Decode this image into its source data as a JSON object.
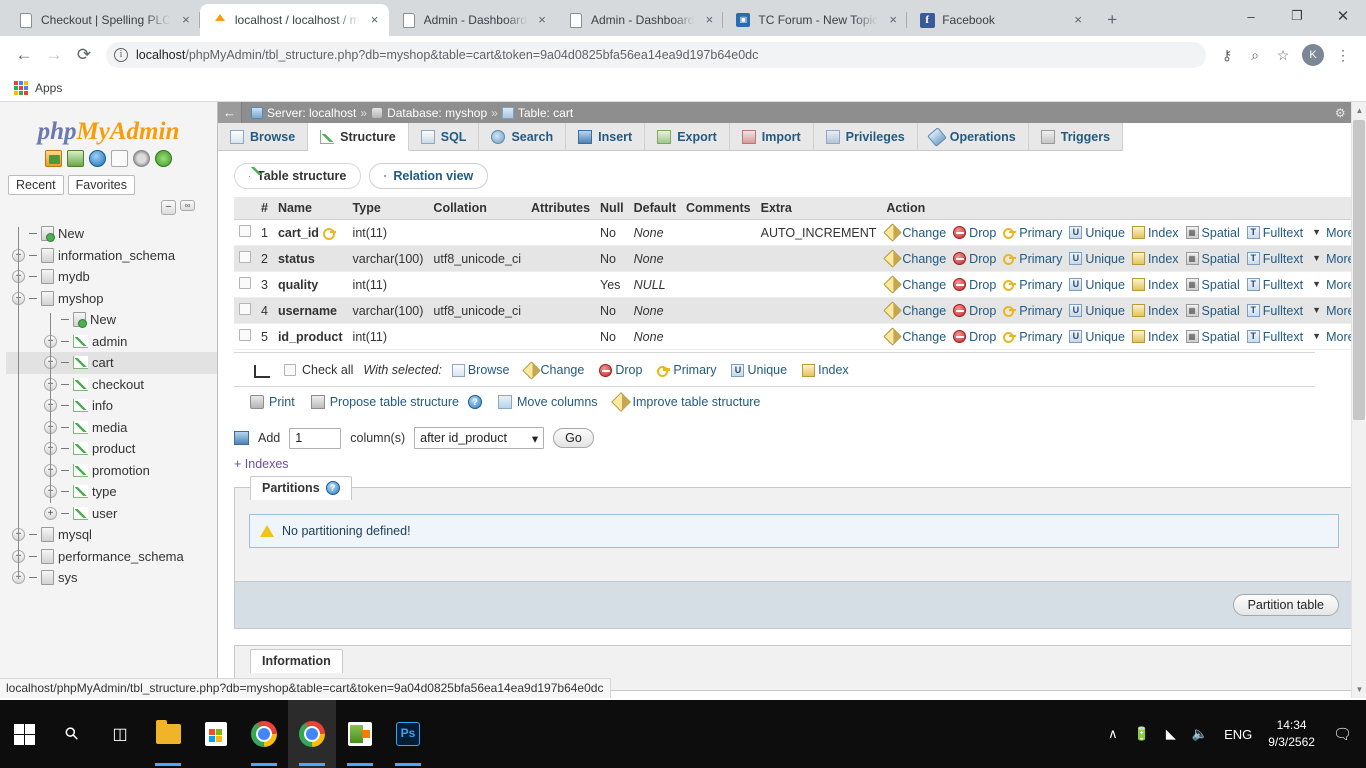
{
  "browser": {
    "tabs": [
      {
        "title": "Checkout | Spelling PLC",
        "favicon": "page-icon",
        "active": false
      },
      {
        "title": "localhost / localhost / m",
        "favicon": "phpmyadmin-icon",
        "active": true
      },
      {
        "title": "Admin - Dashboard",
        "favicon": "page-icon",
        "active": false
      },
      {
        "title": "Admin - Dashboard",
        "favicon": "page-icon",
        "active": false
      },
      {
        "title": "TC Forum - New Topic",
        "favicon": "forum-icon",
        "active": false
      },
      {
        "title": "Facebook",
        "favicon": "facebook-icon",
        "active": false
      }
    ],
    "new_tab_label": "+",
    "close_label": "×",
    "window_controls": {
      "minimize": "–",
      "maximize": "❐",
      "close": "✕"
    },
    "nav": {
      "back": "←",
      "forward": "→",
      "reload": "⟳"
    },
    "omnibox": {
      "url_prefix": "localhost",
      "url_rest": "/phpMyAdmin/tbl_structure.php?db=myshop&table=cart&token=9a04d0825bfa56ea14ea9d197b64e0dc",
      "info_glyph": "i"
    },
    "toolbar_icons": {
      "key": "⚷",
      "search": "⌕",
      "star": "☆",
      "menu": "⋮"
    },
    "profile_initial": "K",
    "bookmarks": {
      "apps_label": "Apps"
    }
  },
  "sidebar": {
    "logo_part1": "php",
    "logo_part2": "MyAdmin",
    "quick_icons": [
      "home-icon",
      "sql-doc-icon",
      "globe-icon",
      "docs-icon",
      "settings-icon",
      "reload-icon"
    ],
    "recent_label": "Recent",
    "favorites_label": "Favorites",
    "collapse_glyph": "−",
    "tree": [
      {
        "label": "New",
        "type": "new",
        "depth": 1,
        "expander": ""
      },
      {
        "label": "information_schema",
        "type": "db",
        "depth": 1,
        "expander": "+"
      },
      {
        "label": "mydb",
        "type": "db",
        "depth": 1,
        "expander": "+"
      },
      {
        "label": "myshop",
        "type": "db",
        "depth": 1,
        "expander": "−"
      },
      {
        "label": "New",
        "type": "new",
        "depth": 2,
        "expander": ""
      },
      {
        "label": "admin",
        "type": "table",
        "depth": 2,
        "expander": "+"
      },
      {
        "label": "cart",
        "type": "table",
        "depth": 2,
        "expander": "+",
        "selected": true
      },
      {
        "label": "checkout",
        "type": "table",
        "depth": 2,
        "expander": "+"
      },
      {
        "label": "info",
        "type": "table",
        "depth": 2,
        "expander": "+"
      },
      {
        "label": "media",
        "type": "table",
        "depth": 2,
        "expander": "+"
      },
      {
        "label": "product",
        "type": "table",
        "depth": 2,
        "expander": "+"
      },
      {
        "label": "promotion",
        "type": "table",
        "depth": 2,
        "expander": "+"
      },
      {
        "label": "type",
        "type": "table",
        "depth": 2,
        "expander": "+"
      },
      {
        "label": "user",
        "type": "table",
        "depth": 2,
        "expander": "+"
      },
      {
        "label": "mysql",
        "type": "db",
        "depth": 1,
        "expander": "+"
      },
      {
        "label": "performance_schema",
        "type": "db",
        "depth": 1,
        "expander": "+"
      },
      {
        "label": "sys",
        "type": "db",
        "depth": 1,
        "expander": "+"
      }
    ]
  },
  "main": {
    "breadcrumb": {
      "back_glyph": "←",
      "server": "Server: localhost",
      "database": "Database: myshop",
      "table": "Table: cart",
      "separator": "»"
    },
    "topbar_right": {
      "settings": "⚙",
      "collapse": "⤒"
    },
    "tabs": [
      {
        "label": "Browse",
        "icon": "browse-icon",
        "active": false
      },
      {
        "label": "Structure",
        "icon": "structure-icon",
        "active": true
      },
      {
        "label": "SQL",
        "icon": "sql-icon",
        "active": false
      },
      {
        "label": "Search",
        "icon": "search-icon",
        "active": false
      },
      {
        "label": "Insert",
        "icon": "insert-icon",
        "active": false
      },
      {
        "label": "Export",
        "icon": "export-icon",
        "active": false
      },
      {
        "label": "Import",
        "icon": "import-icon",
        "active": false
      },
      {
        "label": "Privileges",
        "icon": "privileges-icon",
        "active": false
      },
      {
        "label": "Operations",
        "icon": "operations-icon",
        "active": false
      },
      {
        "label": "Triggers",
        "icon": "triggers-icon",
        "active": false
      }
    ],
    "subtabs": [
      {
        "label": "Table structure",
        "icon": "structure-icon",
        "active": true
      },
      {
        "label": "Relation view",
        "icon": "relation-icon",
        "active": false
      }
    ],
    "structure_table": {
      "headers": [
        "#",
        "Name",
        "Type",
        "Collation",
        "Attributes",
        "Null",
        "Default",
        "Comments",
        "Extra",
        "Action"
      ],
      "rows": [
        {
          "num": "1",
          "name": "cart_id",
          "primary": true,
          "type": "int(11)",
          "collation": "",
          "attributes": "",
          "null": "No",
          "default": "None",
          "comments": "",
          "extra": "AUTO_INCREMENT"
        },
        {
          "num": "2",
          "name": "status",
          "primary": false,
          "type": "varchar(100)",
          "collation": "utf8_unicode_ci",
          "attributes": "",
          "null": "No",
          "default": "None",
          "comments": "",
          "extra": ""
        },
        {
          "num": "3",
          "name": "quality",
          "primary": false,
          "type": "int(11)",
          "collation": "",
          "attributes": "",
          "null": "Yes",
          "default": "NULL",
          "comments": "",
          "extra": ""
        },
        {
          "num": "4",
          "name": "username",
          "primary": false,
          "type": "varchar(100)",
          "collation": "utf8_unicode_ci",
          "attributes": "",
          "null": "No",
          "default": "None",
          "comments": "",
          "extra": ""
        },
        {
          "num": "5",
          "name": "id_product",
          "primary": false,
          "type": "int(11)",
          "collation": "",
          "attributes": "",
          "null": "No",
          "default": "None",
          "comments": "",
          "extra": ""
        }
      ],
      "row_actions": [
        {
          "label": "Change",
          "icon": "pencil-icon"
        },
        {
          "label": "Drop",
          "icon": "drop-icon"
        },
        {
          "label": "Primary",
          "icon": "key-icon"
        },
        {
          "label": "Unique",
          "icon": "unique-icon"
        },
        {
          "label": "Index",
          "icon": "index-icon"
        },
        {
          "label": "Spatial",
          "icon": "spatial-icon"
        },
        {
          "label": "Fulltext",
          "icon": "fulltext-icon"
        },
        {
          "label": "More",
          "icon": "chevron-down-icon"
        }
      ]
    },
    "with_selected": {
      "check_all_label": "Check all",
      "label": "With selected:",
      "actions": [
        {
          "label": "Browse",
          "icon": "browse-icon"
        },
        {
          "label": "Change",
          "icon": "pencil-icon"
        },
        {
          "label": "Drop",
          "icon": "drop-icon"
        },
        {
          "label": "Primary",
          "icon": "key-icon"
        },
        {
          "label": "Unique",
          "icon": "unique-icon"
        },
        {
          "label": "Index",
          "icon": "index-icon"
        }
      ]
    },
    "links": [
      {
        "label": "Print",
        "icon": "print-icon"
      },
      {
        "label": "Propose table structure",
        "icon": "propose-icon",
        "help": true
      },
      {
        "label": "Move columns",
        "icon": "move-icon"
      },
      {
        "label": "Improve table structure",
        "icon": "improve-icon"
      }
    ],
    "add_row": {
      "add_label": "Add",
      "count_value": "1",
      "columns_label": "column(s)",
      "position_value": "after id_product",
      "go_label": "Go",
      "dropdown_glyph": "▾"
    },
    "indexes_link": "+ Indexes",
    "partitions": {
      "legend": "Partitions",
      "help_glyph": "?",
      "notice": "No partitioning defined!",
      "button_label": "Partition table"
    },
    "information_legend": "Information"
  },
  "status_bar": {
    "url": "localhost/phpMyAdmin/tbl_structure.php?db=myshop&table=cart&token=9a04d0825bfa56ea14ea9d197b64e0dc"
  },
  "taskbar": {
    "items": [
      {
        "name": "start-button",
        "icon": "windows-logo-icon"
      },
      {
        "name": "search-button",
        "icon": "search-icon"
      },
      {
        "name": "task-view-button",
        "icon": "task-view-icon"
      },
      {
        "name": "file-explorer",
        "icon": "folder-icon"
      },
      {
        "name": "microsoft-store",
        "icon": "store-icon"
      },
      {
        "name": "chrome-1",
        "icon": "chrome-icon"
      },
      {
        "name": "chrome-2",
        "icon": "chrome-icon"
      },
      {
        "name": "xampp",
        "icon": "xampp-icon"
      },
      {
        "name": "photoshop",
        "icon": "photoshop-icon"
      }
    ],
    "tray": {
      "show_hidden": "∧",
      "battery": "▃",
      "wifi": "◠",
      "volume": "ᵒ))",
      "language": "ENG",
      "time": "14:34",
      "date": "9/3/2562",
      "action_center": "⌨"
    }
  }
}
